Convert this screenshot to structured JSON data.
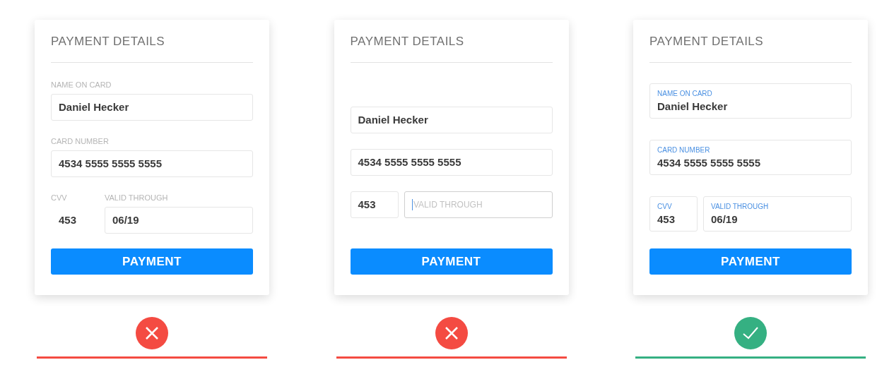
{
  "cards": [
    {
      "title": "PAYMENT DETAILS",
      "kind": "label_above",
      "correct": false,
      "button": "PAYMENT",
      "fields": [
        {
          "label": "NAME ON CARD",
          "value": "Daniel Hecker",
          "bordered": true
        },
        {
          "label": "CARD NUMBER",
          "value": "4534 5555 5555 5555",
          "bordered": true
        },
        {
          "label": "CVV",
          "value": "453",
          "bordered": false
        },
        {
          "label": "VALID THROUGH",
          "value": "06/19",
          "bordered": true
        }
      ]
    },
    {
      "title": "PAYMENT DETAILS",
      "kind": "placeholder_only",
      "correct": false,
      "button": "PAYMENT",
      "fields": [
        {
          "value": "Daniel Hecker",
          "focused": false
        },
        {
          "value": "4534 5555 5555 5555",
          "focused": false
        },
        {
          "value": "453",
          "focused": false
        },
        {
          "placeholder": "VALID THROUGH",
          "focused": true
        }
      ]
    },
    {
      "title": "PAYMENT DETAILS",
      "kind": "label_inside",
      "correct": true,
      "button": "PAYMENT",
      "fields": [
        {
          "label": "NAME ON CARD",
          "value": "Daniel Hecker"
        },
        {
          "label": "CARD NUMBER",
          "value": "4534 5555 5555 5555"
        },
        {
          "label": "CVV",
          "value": "453"
        },
        {
          "label": "VALID THROUGH",
          "value": "06/19"
        }
      ]
    }
  ]
}
